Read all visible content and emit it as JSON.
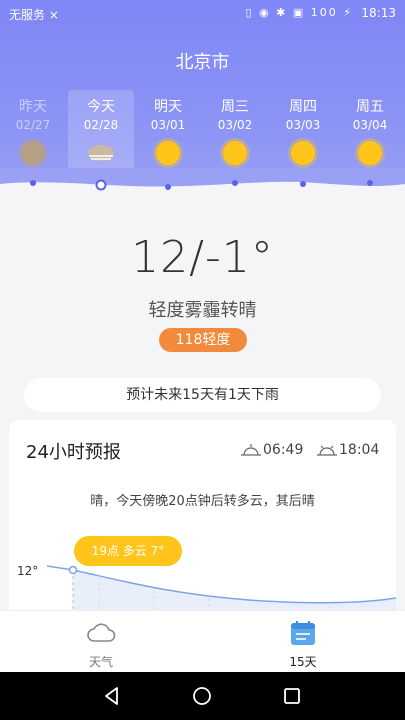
{
  "status_bar": {
    "carrier": "无服务 ×",
    "time": "18:13",
    "icons": "▯ ◉ ✱ ▣ 100 ⚡"
  },
  "city": "北京市",
  "days": [
    {
      "name": "昨天",
      "date": "02/27",
      "icon": "haze-sun-icon",
      "past": true
    },
    {
      "name": "今天",
      "date": "02/28",
      "icon": "haze-cloud-icon",
      "today": true
    },
    {
      "name": "明天",
      "date": "03/01",
      "icon": "sun-icon"
    },
    {
      "name": "周三",
      "date": "03/02",
      "icon": "sun-icon"
    },
    {
      "name": "周四",
      "date": "03/03",
      "icon": "sun-icon"
    },
    {
      "name": "周五",
      "date": "03/04",
      "icon": "sun-icon"
    }
  ],
  "current": {
    "temp": "12/-1°",
    "desc": "轻度雾霾转晴",
    "aqi": "118轻度"
  },
  "rain_note": "预计未来15天有1天下雨",
  "forecast24": {
    "title": "24小时预报",
    "sunrise": "06:49",
    "sunset": "18:04",
    "summary": "晴，今天傍晚20点钟后转多云，其后晴",
    "tooltip": "19点 多云 7°",
    "y_top": "12°"
  },
  "tabs": [
    {
      "label": "天气",
      "icon": "cloud-icon"
    },
    {
      "label": "15天",
      "icon": "calendar-icon",
      "active": true
    }
  ],
  "colors": {
    "header": "#7f86f6",
    "accent_sun": "#ffc51a",
    "aqi": "#f28a3b",
    "line": "#7ea4e6"
  }
}
